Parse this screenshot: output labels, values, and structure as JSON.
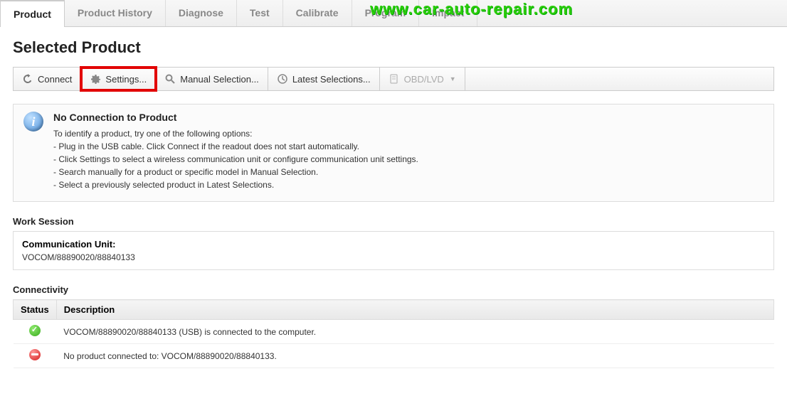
{
  "watermark": "www.car-auto-repair.com",
  "tabs": [
    {
      "label": "Product",
      "active": true
    },
    {
      "label": "Product History",
      "active": false
    },
    {
      "label": "Diagnose",
      "active": false
    },
    {
      "label": "Test",
      "active": false
    },
    {
      "label": "Calibrate",
      "active": false
    },
    {
      "label": "Program",
      "active": false
    },
    {
      "label": "Impact",
      "active": false
    }
  ],
  "title": "Selected Product",
  "toolbar": {
    "connect": "Connect",
    "settings": "Settings...",
    "manual": "Manual Selection...",
    "latest": "Latest Selections...",
    "obd": "OBD/LVD"
  },
  "info": {
    "title": "No Connection to Product",
    "intro": "To identify a product, try one of the following options:",
    "lines": [
      "- Plug in the USB cable. Click Connect if the readout does not start automatically.",
      "- Click Settings to select a wireless communication unit or configure communication unit settings.",
      "- Search manually for a product or specific model in Manual Selection.",
      "- Select a previously selected product in Latest Selections."
    ]
  },
  "work_session": {
    "label": "Work Session",
    "comm_label": "Communication Unit:",
    "comm_value": "VOCOM/88890020/88840133"
  },
  "connectivity": {
    "label": "Connectivity",
    "headers": {
      "status": "Status",
      "description": "Description"
    },
    "rows": [
      {
        "status": "ok",
        "text": "VOCOM/88890020/88840133 (USB) is connected to the computer."
      },
      {
        "status": "err",
        "text": "No product connected to: VOCOM/88890020/88840133."
      }
    ]
  }
}
